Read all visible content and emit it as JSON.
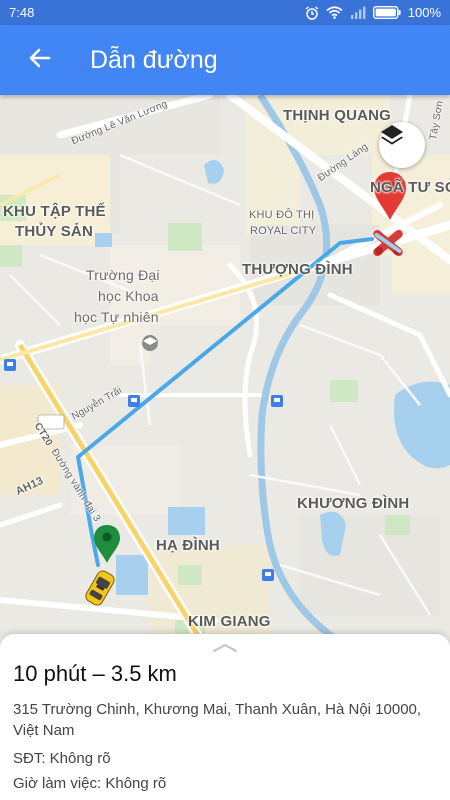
{
  "status_bar": {
    "time": "7:48",
    "battery": "100%",
    "icons": [
      "alarm-icon",
      "wifi-icon",
      "signal-icon",
      "battery-icon"
    ]
  },
  "app_bar": {
    "back_icon": "arrow-back-icon",
    "title": "Dẫn đường",
    "color": "#4285f4"
  },
  "map": {
    "labels": {
      "thinh_quang": "THỊNH QUANG",
      "nga_tu_so": "NGÃ TƯ SỞ",
      "khu_tap_the_1": "KHU TẬP THỂ",
      "khu_tap_the_2": "THỦY SẢN",
      "khu_do_thi_1": "KHU ĐÔ THỊ",
      "khu_do_thi_2": "ROYAL CITY",
      "thuong_dinh": "THƯỢNG ĐÌNH",
      "truong_dh_1": "Trường Đại",
      "truong_dh_2": "học Khoa",
      "truong_dh_3": "học Tự nhiên",
      "khuong_dinh": "KHƯƠNG ĐÌNH",
      "ha_dinh": "HẠ ĐÌNH",
      "kim_giang": "KIM GIANG",
      "duong_le_van_luong": "Đường Lê Văn Lương",
      "duong_lang": "Đường Láng",
      "tay_son": "Tây Sơn",
      "nguyen_trai": "Nguyễn Trãi",
      "ct20": "CT20",
      "duong_vanh_dai_3": "Đường vành đai 3",
      "ah13": "AH13"
    },
    "route_color": "#4aa8e8",
    "destination_pin_color": "#e53935",
    "origin_pin_color": "#1e8e3e",
    "layers_button_icon": "layers-icon"
  },
  "sheet": {
    "handle_icon": "chevron-up-icon",
    "summary": "10 phút – 3.5 km",
    "address": "315 Trường Chinh, Khương Mai, Thanh Xuân, Hà Nội 10000, Việt Nam",
    "phone": "SĐT: Không rõ",
    "hours": "Giờ làm việc: Không rõ"
  }
}
